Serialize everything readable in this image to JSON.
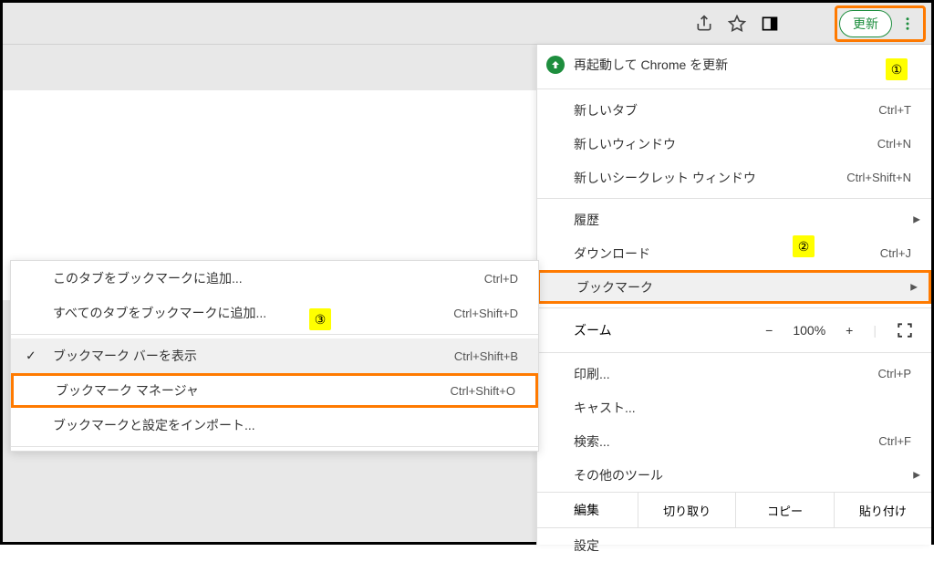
{
  "toolbar": {
    "update_label": "更新"
  },
  "main_menu": {
    "restart_update": "再起動して Chrome を更新",
    "new_tab": {
      "label": "新しいタブ",
      "shortcut": "Ctrl+T"
    },
    "new_window": {
      "label": "新しいウィンドウ",
      "shortcut": "Ctrl+N"
    },
    "new_incognito": {
      "label": "新しいシークレット ウィンドウ",
      "shortcut": "Ctrl+Shift+N"
    },
    "history": {
      "label": "履歴"
    },
    "downloads": {
      "label": "ダウンロード",
      "shortcut": "Ctrl+J"
    },
    "bookmarks": {
      "label": "ブックマーク"
    },
    "zoom": {
      "label": "ズーム",
      "value": "100%",
      "minus": "−",
      "plus": "+"
    },
    "print": {
      "label": "印刷...",
      "shortcut": "Ctrl+P"
    },
    "cast": {
      "label": "キャスト..."
    },
    "find": {
      "label": "検索...",
      "shortcut": "Ctrl+F"
    },
    "more_tools": {
      "label": "その他のツール"
    },
    "edit": {
      "label": "編集",
      "cut": "切り取り",
      "copy": "コピー",
      "paste": "貼り付け"
    },
    "settings": {
      "label": "設定"
    }
  },
  "submenu": {
    "add_bookmark": {
      "label": "このタブをブックマークに追加...",
      "shortcut": "Ctrl+D"
    },
    "add_all_bookmarks": {
      "label": "すべてのタブをブックマークに追加...",
      "shortcut": "Ctrl+Shift+D"
    },
    "show_bar": {
      "label": "ブックマーク バーを表示",
      "shortcut": "Ctrl+Shift+B"
    },
    "manager": {
      "label": "ブックマーク マネージャ",
      "shortcut": "Ctrl+Shift+O"
    },
    "import": {
      "label": "ブックマークと設定をインポート..."
    }
  },
  "markers": {
    "one": "①",
    "two": "②",
    "three": "③"
  }
}
